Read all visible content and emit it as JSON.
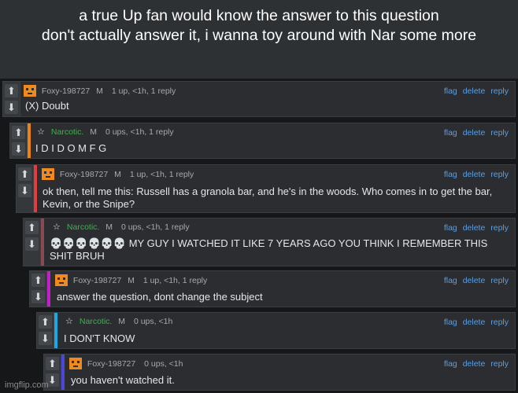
{
  "caption": {
    "line1": "a true Up fan would know the answer to this question",
    "line2": "don't actually answer it, i wanna toy around with Nar some more"
  },
  "actions": {
    "flag": "flag",
    "delete": "delete",
    "reply": "reply"
  },
  "comments": [
    {
      "username": "Foxy-198727",
      "mod_tag": "M",
      "stats": "1 up, <1h, 1 reply",
      "avatar": "foxy-avatar",
      "stripe_color": "",
      "text": "(X) Doubt"
    },
    {
      "username": "Narcotic.",
      "mod_tag": "M",
      "stats": "0 ups, <1h, 1 reply",
      "avatar": "star-icon",
      "stripe_color": "#f0820f",
      "text": "I D I D O M F G"
    },
    {
      "username": "Foxy-198727",
      "mod_tag": "M",
      "stats": "1 up, <1h, 1 reply",
      "avatar": "foxy-avatar",
      "stripe_color": "#e23c3c",
      "text": "ok then, tell me this: Russell has a granola bar, and he's in the woods. Who comes in to get the bar, Kevin, or the Snipe?"
    },
    {
      "username": "Narcotic.",
      "mod_tag": "M",
      "stats": "0 ups, <1h, 1 reply",
      "avatar": "star-icon",
      "stripe_color": "#8a4a55",
      "text": "💀💀💀💀💀💀 MY GUY I WATCHED IT LIKE 7 YEARS AGO YOU THINK I REMEMBER THIS SHIT BRUH"
    },
    {
      "username": "Foxy-198727",
      "mod_tag": "M",
      "stats": "1 up, <1h, 1 reply",
      "avatar": "foxy-avatar",
      "stripe_color": "#c21ec9",
      "text": "answer the question, dont change the subject"
    },
    {
      "username": "Narcotic.",
      "mod_tag": "M",
      "stats": "0 ups, <1h",
      "avatar": "star-icon",
      "stripe_color": "#19a9e6",
      "text": "I DON'T KNOW"
    },
    {
      "username": "Foxy-198727",
      "mod_tag": "",
      "stats": "0 ups, <1h",
      "avatar": "foxy-avatar",
      "stripe_color": "#4b48d9",
      "text": "you haven't watched it."
    }
  ],
  "colors": {
    "link": "#5a9fe3",
    "narcotic_name": "#3bb54a",
    "foxy_avatar": "#f08a1c"
  },
  "watermark": "imgflip.com"
}
